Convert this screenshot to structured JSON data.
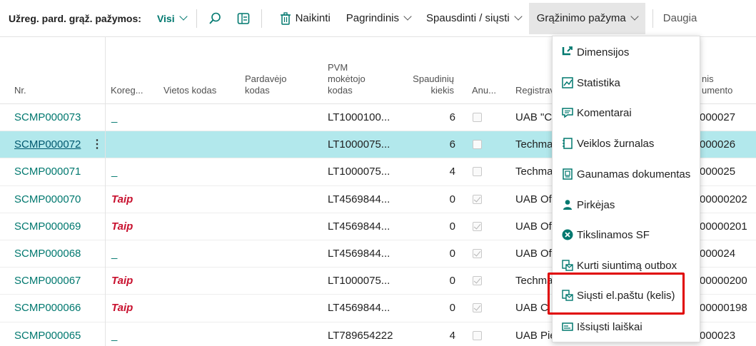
{
  "toolbar": {
    "title": "Užreg. pard. grąž. pažymos:",
    "view": "Visi",
    "delete_label": "Naikinti",
    "main_label": "Pagrindinis",
    "print_label": "Spausdinti / siųsti",
    "return_label": "Grąžinimo pažyma",
    "more_label": "Daugia"
  },
  "columns": {
    "nr": "Nr.",
    "kor": "Koreg...",
    "vietos": "Vietos kodas",
    "pardavejo": [
      "Pardavėjo",
      "kodas"
    ],
    "pvm": [
      "PVM",
      "mokėtojo",
      "kodas"
    ],
    "kiekis": [
      "Spaudinių",
      "kiekis"
    ],
    "anu": "Anu...",
    "reg": "Registrav",
    "doc": [
      "nis",
      "umento"
    ]
  },
  "rows": [
    {
      "nr": "SCMP000073",
      "kor": "_",
      "pvm": "LT1000100...",
      "kiekis": "6",
      "anu": false,
      "reg": "UAB \"C",
      "doc": "000027"
    },
    {
      "nr": "SCMP000072",
      "kor": "",
      "pvm": "LT1000075...",
      "kiekis": "6",
      "anu": false,
      "reg": "Techma",
      "doc": "000026",
      "selected": true
    },
    {
      "nr": "SCMP000071",
      "kor": "_",
      "pvm": "LT1000075...",
      "kiekis": "4",
      "anu": false,
      "reg": "Techma",
      "doc": "000025"
    },
    {
      "nr": "SCMP000070",
      "kor": "Taip",
      "pvm": "LT4569844...",
      "kiekis": "0",
      "anu": true,
      "reg": "UAB Of",
      "doc": "00000202"
    },
    {
      "nr": "SCMP000069",
      "kor": "Taip",
      "pvm": "LT4569844...",
      "kiekis": "0",
      "anu": true,
      "reg": "UAB Of",
      "doc": "00000201"
    },
    {
      "nr": "SCMP000068",
      "kor": "_",
      "pvm": "LT4569844...",
      "kiekis": "0",
      "anu": true,
      "reg": "UAB Of",
      "doc": "000024"
    },
    {
      "nr": "SCMP000067",
      "kor": "Taip",
      "pvm": "LT1000075...",
      "kiekis": "0",
      "anu": true,
      "reg": "Techma",
      "doc": "00000200"
    },
    {
      "nr": "SCMP000066",
      "kor": "Taip",
      "pvm": "LT4569844...",
      "kiekis": "0",
      "anu": true,
      "reg": "UAB C",
      "doc": "00000198"
    },
    {
      "nr": "SCMP000065",
      "kor": "_",
      "pvm": "LT789654222",
      "kiekis": "4",
      "anu": false,
      "reg": "UAB Pie",
      "doc": "000023"
    }
  ],
  "menu": [
    {
      "label": "Dimensijos",
      "icon": "dimensions-icon"
    },
    {
      "label": "Statistika",
      "icon": "statistics-icon"
    },
    {
      "label": "Komentarai",
      "icon": "comments-icon"
    },
    {
      "label": "Veiklos žurnalas",
      "icon": "activity-log-icon"
    },
    {
      "label": "Gaunamas dokumentas",
      "icon": "incoming-document-icon"
    },
    {
      "label": "Pirkėjas",
      "icon": "customer-icon"
    },
    {
      "label": "Tikslinamos SF",
      "icon": "corrective-invoice-icon"
    },
    {
      "label": "Kurti siuntimą outbox",
      "icon": "outbox-icon"
    },
    {
      "label": "Siųsti el.paštu (kelis)",
      "icon": "email-send-icon"
    },
    {
      "label": "Išsiųsti laiškai",
      "icon": "sent-mail-icon"
    }
  ],
  "colors": {
    "accent": "#00786f",
    "selected_row": "#b2e8ec",
    "taip": "#c8102e",
    "highlight": "#e00000"
  }
}
